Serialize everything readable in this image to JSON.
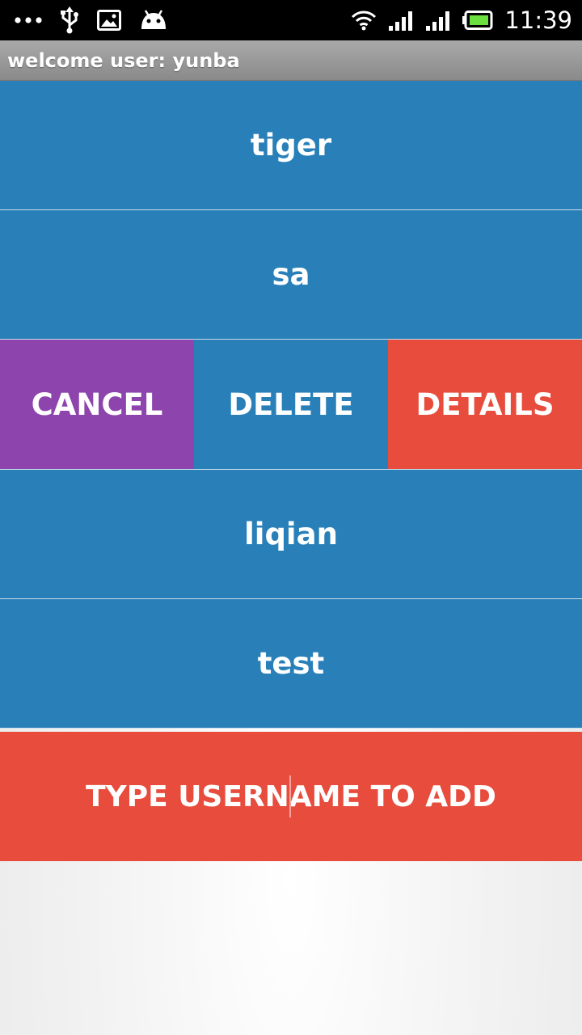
{
  "status_bar": {
    "time": "11:39",
    "icons": [
      "more-dots-icon",
      "usb-icon",
      "image-icon",
      "android-icon",
      "wifi-icon",
      "signal-icon",
      "signal-icon",
      "battery-icon"
    ]
  },
  "header": {
    "title": "welcome user: yunba"
  },
  "users": [
    {
      "name": "tiger"
    },
    {
      "name": "sa"
    },
    {
      "name": "liqian"
    },
    {
      "name": "test"
    }
  ],
  "swipe_actions": {
    "cancel": "CANCEL",
    "delete": "DELETE",
    "details": "DETAILS"
  },
  "add_user": {
    "placeholder": "TYPE USERNAME TO ADD",
    "value": ""
  },
  "colors": {
    "row": "#2980b9",
    "cancel": "#8e44ad",
    "delete": "#2980b9",
    "details": "#e74c3c",
    "add": "#e74c3c"
  }
}
